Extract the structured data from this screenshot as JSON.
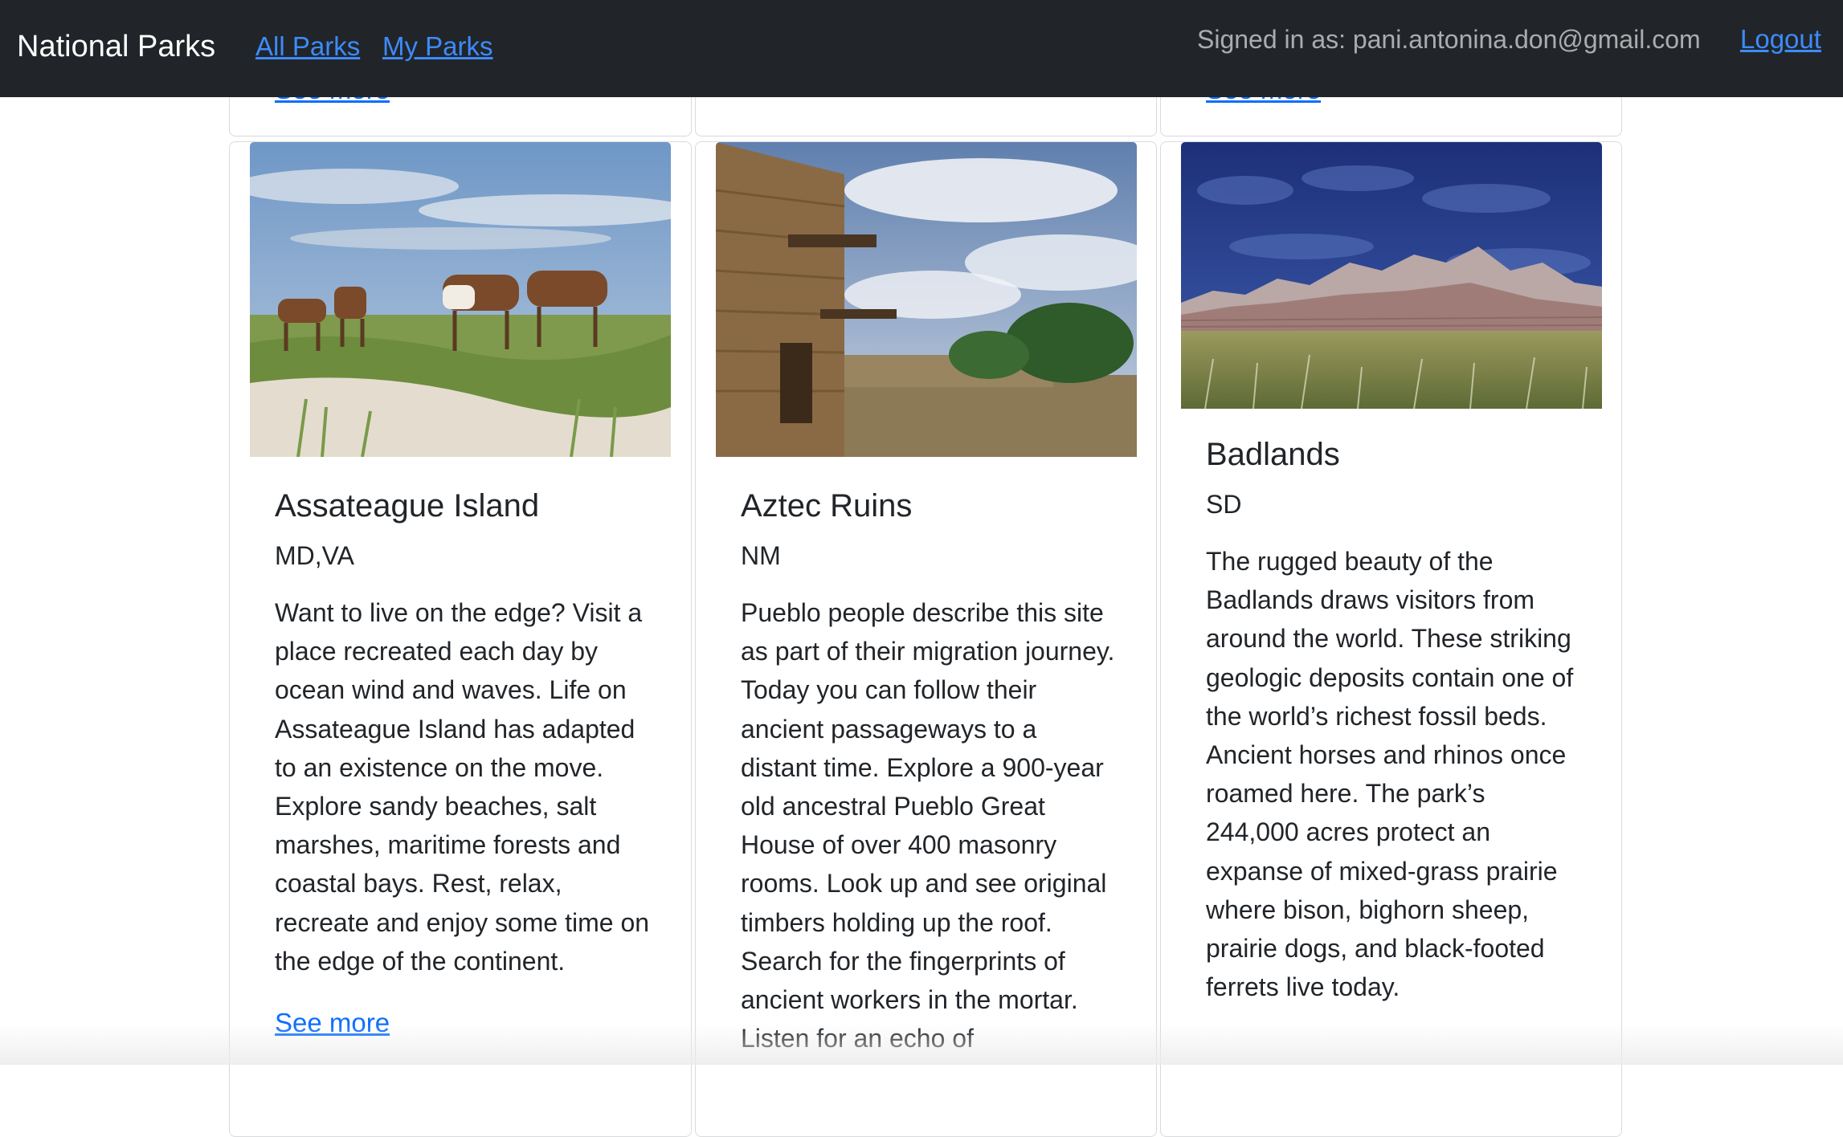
{
  "navbar": {
    "brand": "National Parks",
    "links": [
      {
        "label": "All Parks"
      },
      {
        "label": "My Parks"
      }
    ],
    "signed_in": "Signed in as: pani.antonina.don@gmail.com",
    "logout": "Logout"
  },
  "previous_row": {
    "link_label": "See more"
  },
  "parks": [
    {
      "name": "Assateague Island",
      "states": "MD,VA",
      "description": "Want to live on the edge? Visit a place recreated each day by ocean wind and waves. Life on Assateague Island has adapted to an existence on the move. Explore sandy beaches, salt marshes, maritime forests and coastal bays. Rest, relax, recreate and enjoy some time on the edge of the continent.",
      "link_label": "See more",
      "image_icon": "wild-horses-photo"
    },
    {
      "name": "Aztec Ruins",
      "states": "NM",
      "description": "Pueblo people describe this site as part of their migration journey. Today you can follow their ancient passageways to a distant time. Explore a 900-year old ancestral Pueblo Great House of over 400 masonry rooms. Look up and see original timbers holding up the roof. Search for the fingerprints of ancient workers in the mortar. Listen for an echo of",
      "image_icon": "stone-ruins-photo"
    },
    {
      "name": "Badlands",
      "states": "SD",
      "description": "The rugged beauty of the Badlands draws visitors from around the world. These striking geologic deposits contain one of the world’s richest fossil beds. Ancient horses and rhinos once roamed here. The park’s 244,000 acres protect an expanse of mixed-grass prairie where bison, bighorn sheep, prairie dogs, and black-footed ferrets live today.",
      "image_icon": "badlands-prairie-photo"
    }
  ],
  "colors": {
    "navbar_bg": "#212529",
    "link": "#0d6efd",
    "nav_link": "#3d8bfd",
    "card_border": "#d8dadd"
  }
}
